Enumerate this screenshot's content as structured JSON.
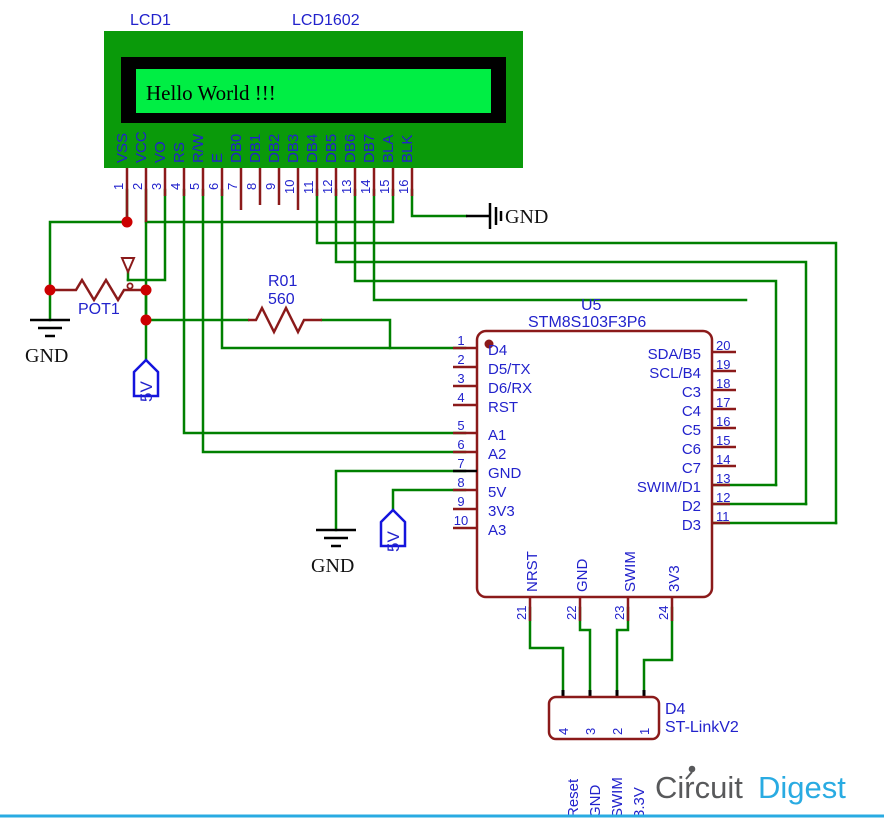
{
  "schematic": {
    "title_parts": {
      "lcd_ref": "LCD1",
      "lcd_value": "LCD1602",
      "mcu_ref": "U5",
      "mcu_value": "STM8S103F3P6",
      "conn_ref": "D4",
      "conn_value": "ST-LinkV2",
      "pot_ref": "POT1",
      "res_ref": "R01",
      "res_value": "560"
    },
    "lcd": {
      "screen_text": "Hello World !!!",
      "body_color": "#0a9a0a",
      "bezel_color": "#000000",
      "screen_color": "#00ee44",
      "pins": [
        {
          "num": "1",
          "name": "VSS"
        },
        {
          "num": "2",
          "name": "VCC"
        },
        {
          "num": "3",
          "name": "VO"
        },
        {
          "num": "4",
          "name": "RS"
        },
        {
          "num": "5",
          "name": "R/W"
        },
        {
          "num": "6",
          "name": "E"
        },
        {
          "num": "7",
          "name": "DB0"
        },
        {
          "num": "8",
          "name": "DB1"
        },
        {
          "num": "9",
          "name": "DB2"
        },
        {
          "num": "10",
          "name": "DB3"
        },
        {
          "num": "11",
          "name": "DB4"
        },
        {
          "num": "12",
          "name": "DB5"
        },
        {
          "num": "13",
          "name": "DB6"
        },
        {
          "num": "14",
          "name": "DB7"
        },
        {
          "num": "15",
          "name": "BLA"
        },
        {
          "num": "16",
          "name": "BLK"
        }
      ]
    },
    "mcu": {
      "left_pins": [
        {
          "num": "1",
          "name": "D4"
        },
        {
          "num": "2",
          "name": "D5/TX"
        },
        {
          "num": "3",
          "name": "D6/RX"
        },
        {
          "num": "4",
          "name": "RST"
        },
        {
          "num": "5",
          "name": "A1"
        },
        {
          "num": "6",
          "name": "A2"
        },
        {
          "num": "7",
          "name": "GND"
        },
        {
          "num": "8",
          "name": "5V"
        },
        {
          "num": "9",
          "name": "3V3"
        },
        {
          "num": "10",
          "name": "A3"
        }
      ],
      "right_pins": [
        {
          "num": "20",
          "name": "SDA/B5"
        },
        {
          "num": "19",
          "name": "SCL/B4"
        },
        {
          "num": "18",
          "name": "C3"
        },
        {
          "num": "17",
          "name": "C4"
        },
        {
          "num": "16",
          "name": "C5"
        },
        {
          "num": "15",
          "name": "C6"
        },
        {
          "num": "14",
          "name": "C7"
        },
        {
          "num": "13",
          "name": "SWIM/D1"
        },
        {
          "num": "12",
          "name": "D2"
        },
        {
          "num": "11",
          "name": "D3"
        }
      ],
      "bottom_pins": [
        {
          "num": "21",
          "name": "NRST"
        },
        {
          "num": "22",
          "name": "GND"
        },
        {
          "num": "23",
          "name": "SWIM"
        },
        {
          "num": "24",
          "name": "3V3"
        }
      ]
    },
    "connector": {
      "pins": [
        {
          "num": "4",
          "name": "Reset"
        },
        {
          "num": "3",
          "name": "GND"
        },
        {
          "num": "2",
          "name": "SWIM"
        },
        {
          "num": "1",
          "name": "3.3V"
        }
      ]
    },
    "power_symbols": {
      "gnd_label": "GND",
      "v5_label": "5V"
    },
    "colors": {
      "wire": "#008000",
      "component": "#8b1a1a",
      "label": "#2222cc",
      "junction": "#cc0000"
    },
    "logo": {
      "part1": "Circuit",
      "part2": "Digest"
    }
  }
}
